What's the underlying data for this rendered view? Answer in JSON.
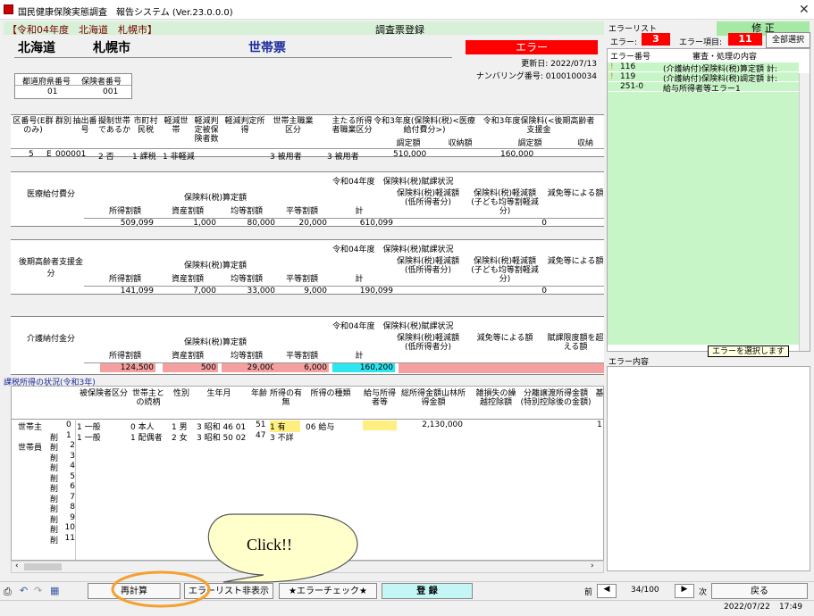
{
  "window": {
    "title": "国民健康保険実態調査　報告システム (Ver.23.0.0.0)"
  },
  "header": {
    "year_region": "【令和04年度　北海道　札幌市】",
    "screen": "調査票登録",
    "mode_button": "修 正"
  },
  "big": {
    "pref": "北海道",
    "city": "札幌市",
    "form_type": "世帯票"
  },
  "error_banner": "エラー",
  "updated": "更新日: 2022/07/13",
  "numbering": "ナンバリング番号: 0100100034",
  "codes": {
    "pref_label": "都道府県番号",
    "pref_value": "01",
    "insurer_label": "保険者番号",
    "insurer_value": "001"
  },
  "household": {
    "headers": [
      "区番号(E群のみ)",
      "群別",
      "抽出番号",
      "擬制世帯であるか",
      "市町村民税",
      "軽減世帯",
      "軽減判定被保険者数",
      "軽減判定所得",
      "世帯主職業区分",
      "主たる所得者職業区分",
      "令和3年度(保険料(税)<医療給付費分>)",
      "令和3年度保険料(<後期高齢者支援金"
    ],
    "sub_headers": [
      "調定額",
      "収納額",
      "調定額",
      "収納"
    ],
    "row": [
      "5",
      "E",
      "000001",
      "2 否",
      "1 課税",
      "1 非軽減",
      "",
      "",
      "3 被用者",
      "3 被用者",
      "510,000",
      "",
      "160,000",
      ""
    ]
  },
  "sections": [
    {
      "name": "医療給付費分",
      "title": "令和04年度　保険料(税)賦課状況",
      "group": "保険料(税)算定額",
      "cols": [
        "所得割額",
        "資産割額",
        "均等割額",
        "平等割額",
        "計"
      ],
      "extra": [
        "保険料(税)軽減額(低所得者分)",
        "保険料(税)軽減額(子ども均等割軽減分)",
        "減免等による額"
      ],
      "values": [
        "509,099",
        "1,000",
        "80,000",
        "20,000",
        "610,099"
      ],
      "extra_values": [
        "",
        "0",
        ""
      ]
    },
    {
      "name": "後期高齢者支援金分",
      "title": "令和04年度　保険料(税)賦課状況",
      "group": "保険料(税)算定額",
      "cols": [
        "所得割額",
        "資産割額",
        "均等割額",
        "平等割額",
        "計"
      ],
      "extra": [
        "保険料(税)軽減額(低所得者分)",
        "保険料(税)軽減額(子ども均等割軽減分)",
        "減免等による額"
      ],
      "values": [
        "141,099",
        "7,000",
        "33,000",
        "9,000",
        "190,099"
      ],
      "extra_values": [
        "",
        "0",
        ""
      ]
    },
    {
      "name": "介護納付金分",
      "title": "令和04年度　保険料(税)賦課状況",
      "group": "保険料(税)算定額",
      "cols": [
        "所得割額",
        "資産割額",
        "均等割額",
        "平等割額",
        "計"
      ],
      "extra": [
        "保険料(税)軽減額(低所得者分)",
        "減免等による額",
        "賦課限度額を超える額"
      ],
      "values": [
        "124,500",
        "500",
        "29,000",
        "6,000",
        "160,200"
      ],
      "extra_values": [
        "",
        "",
        ""
      ]
    }
  ],
  "income": {
    "title": "課税所得の状況(令和3年)",
    "headers": [
      "被保険者区分",
      "世帯主との続柄",
      "性別",
      "生年月",
      "年齢",
      "所得の有無",
      "所得の種類",
      "給与所得者等",
      "総所得金額山林所得金額",
      "雑損失の繰越控除額",
      "分離譲渡所得金額(特別控除後の金額)",
      "基"
    ],
    "rows": [
      {
        "label": "世帯主",
        "idx": "0",
        "kubun": "1 一般",
        "zoku": "0 本人",
        "sex": "1 男",
        "birth": "3 昭和 46 01",
        "age": "51",
        "umu": "1 有",
        "kind": "06 給与",
        "kyuyo": "",
        "total": "2,130,000",
        "zatsu": "",
        "bunri": "",
        "ki": "1"
      },
      {
        "label": "",
        "idx": "1",
        "kubun": "1 一般",
        "zoku": "1 配偶者",
        "sex": "2 女",
        "birth": "3 昭和 50 02",
        "age": "47",
        "umu": "3 不詳",
        "kind": "",
        "kyuyo": "",
        "total": "",
        "zatsu": "",
        "bunri": "",
        "ki": ""
      }
    ],
    "member_label": "世帯員",
    "row_prefix": "削",
    "empty_rows": [
      "2",
      "3",
      "4",
      "5",
      "6",
      "7",
      "8",
      "9",
      "10",
      "11"
    ]
  },
  "right": {
    "list_title": "エラーリスト",
    "err_label": "エラー:",
    "err_count": "3",
    "item_label": "エラー項目:",
    "item_count": "11",
    "select_all": "全部選択",
    "col_no": "エラー番号",
    "col_desc": "審査・処理の内容",
    "errors": [
      {
        "mark": "!",
        "no": "116",
        "desc": "(介護納付)保険料(税)算定額 計:"
      },
      {
        "mark": "!",
        "no": "119",
        "desc": "(介護納付)保険料(税)調定額 計:"
      },
      {
        "mark": "",
        "no": "251-0",
        "desc": "給与所得者等エラー1"
      }
    ],
    "tooltip": "エラーを選択します",
    "content_label": "エラー内容"
  },
  "toolbar": {
    "recalc": "再計算",
    "hide_errors": "エラーリスト非表示",
    "err_check": "★エラーチェック★",
    "register": "登 録",
    "prev": "前",
    "page": "34/100",
    "next": "次",
    "back": "戻る"
  },
  "callout": "Click!!",
  "status": {
    "date": "2022/07/22",
    "time": "17:49"
  }
}
